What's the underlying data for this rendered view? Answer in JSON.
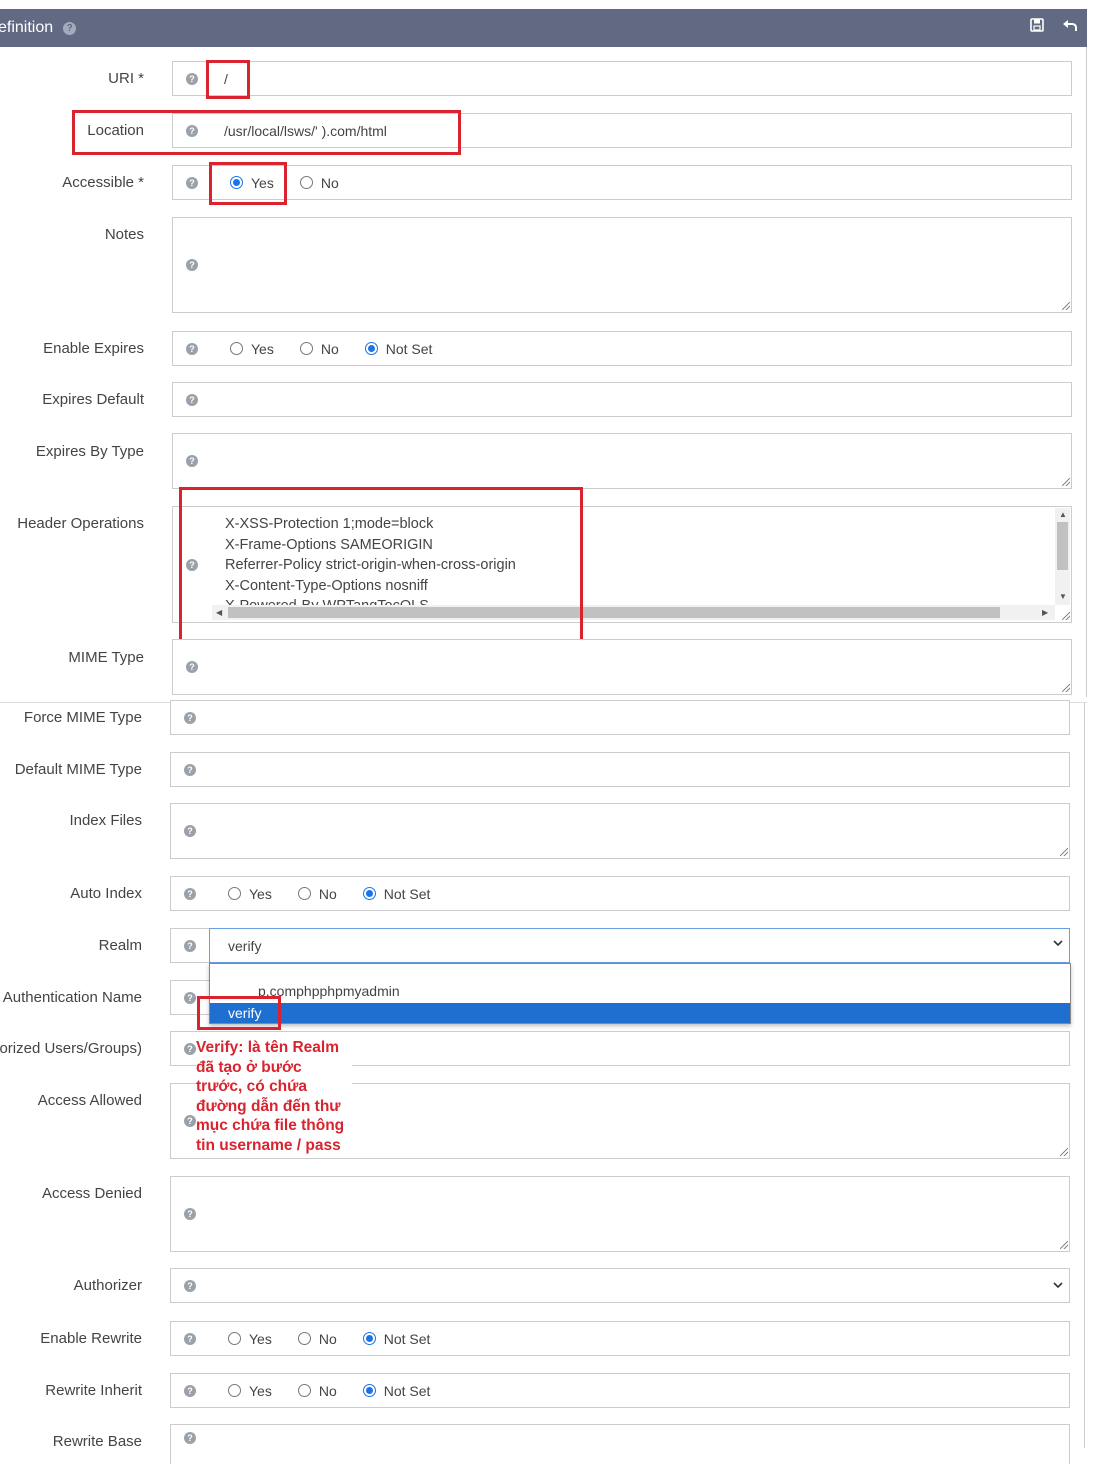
{
  "header": {
    "title": "efinition",
    "save_icon": "save-icon",
    "back_icon": "undo-icon"
  },
  "fields": {
    "uri": {
      "label": "URI *",
      "value": "/"
    },
    "location": {
      "label": "Location",
      "value": "/usr/local/lsws/'        ).com/html"
    },
    "accessible": {
      "label": "Accessible *",
      "options": [
        "Yes",
        "No"
      ],
      "selected": "Yes"
    },
    "notes": {
      "label": "Notes",
      "value": ""
    },
    "enable_expires": {
      "label": "Enable Expires",
      "options": [
        "Yes",
        "No",
        "Not Set"
      ],
      "selected": "Not Set"
    },
    "expires_default": {
      "label": "Expires Default",
      "value": ""
    },
    "expires_by_type": {
      "label": "Expires By Type",
      "value": ""
    },
    "header_operations": {
      "label": "Header Operations",
      "lines": [
        "X-XSS-Protection 1;mode=block",
        "X-Frame-Options SAMEORIGIN",
        "Referrer-Policy strict-origin-when-cross-origin",
        "X-Content-Type-Options nosniff",
        "X-Powered-By WPTangTocOLS"
      ]
    },
    "mime_type": {
      "label": "MIME Type",
      "value": ""
    },
    "force_mime_type": {
      "label": "Force MIME Type",
      "value": ""
    },
    "default_mime_type": {
      "label": "Default MIME Type",
      "value": ""
    },
    "index_files": {
      "label": "Index Files",
      "value": ""
    },
    "auto_index": {
      "label": "Auto Index",
      "options": [
        "Yes",
        "No",
        "Not Set"
      ],
      "selected": "Not Set"
    },
    "realm": {
      "label": "Realm",
      "value": "verify",
      "dropdown_options": [
        "p.comphpphpmyadmin",
        "verify"
      ],
      "highlighted": "verify"
    },
    "authentication_name": {
      "label": "Authentication Name",
      "value": ""
    },
    "required": {
      "label": "orized Users/Groups)",
      "value": ""
    },
    "access_allowed": {
      "label": "Access Allowed",
      "value": ""
    },
    "access_denied": {
      "label": "Access Denied",
      "value": ""
    },
    "authorizer": {
      "label": "Authorizer",
      "value": ""
    },
    "enable_rewrite": {
      "label": "Enable Rewrite",
      "options": [
        "Yes",
        "No",
        "Not Set"
      ],
      "selected": "Not Set"
    },
    "rewrite_inherit": {
      "label": "Rewrite Inherit",
      "options": [
        "Yes",
        "No",
        "Not Set"
      ],
      "selected": "Not Set"
    },
    "rewrite_base": {
      "label": "Rewrite Base",
      "value": ""
    }
  },
  "annotation": "Verify: là tên Realm đã tạo ở bước trước, có chứa đường dẫn đến thư mục chứa file thông tin username / pass",
  "colors": {
    "header": "#616a82",
    "highlight_box": "#d9232e",
    "selected_option": "#1f6fd1",
    "radio_on": "#1a73e8"
  }
}
